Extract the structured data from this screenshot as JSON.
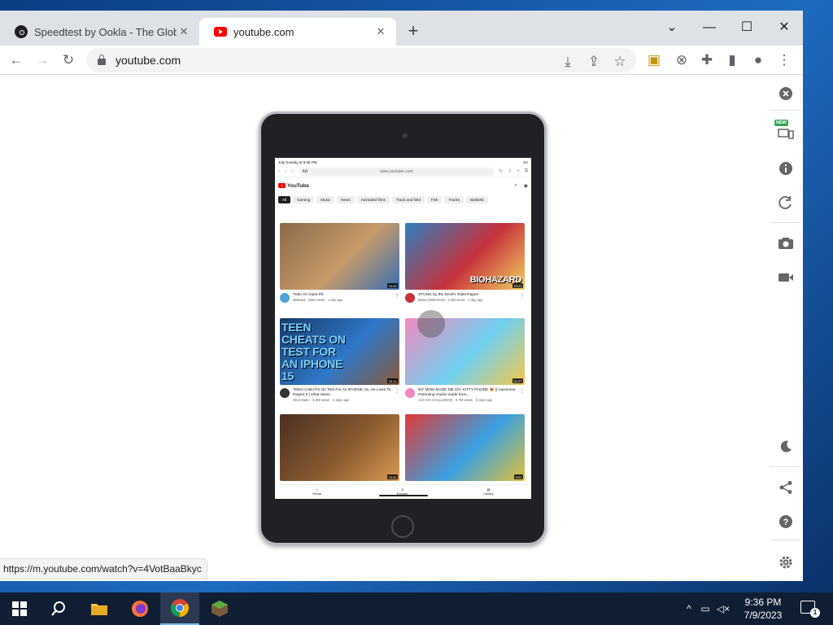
{
  "tabs": [
    {
      "title": "Speedtest by Ookla - The Global",
      "active": false
    },
    {
      "title": "youtube.com",
      "active": true
    }
  ],
  "omnibox": {
    "url": "youtube.com"
  },
  "status_url": "https://m.youtube.com/watch?v=4VotBaaBkyc",
  "device": {
    "status_time": "July Sunday at 9:36 PM",
    "status_right": "4G",
    "safari_url": "www.youtube.com",
    "aa": "AA",
    "logo": "YouTube",
    "chips": [
      "All",
      "Gaming",
      "Music",
      "News",
      "Animated films",
      "Track and field",
      "Fish",
      "Trucks",
      "Basketb"
    ],
    "videos": [
      {
        "title": "Train Vs Giant Pit",
        "sub": "MrBeast · 63M views · 1 day ago",
        "duration": "10:26",
        "thumb_text": "",
        "colors": [
          "#8b6a4a",
          "#c79a6a",
          "#3a6fb0"
        ],
        "avatar": "#4aa3d8"
      },
      {
        "title": "STUNG by the Devil's Toilet Paper!",
        "sub": "Brave Wilderness · 2.3M views · 1 day ago",
        "duration": "10:21",
        "thumb_text": "BIOHAZARD",
        "colors": [
          "#2f7fbf",
          "#c8323c",
          "#f0d060"
        ],
        "avatar": "#c8323c"
      },
      {
        "title": "TEEN CHEATS On Test For An IPHONE 15, He Lives To Regret It | Dhar Mann",
        "sub": "Dhar Mann · 5.3M views · 4 days ago",
        "duration": "16:14",
        "thumb_text": "TEEN CHEATS ON TEST FOR AN IPHONE 15",
        "colors": [
          "#173a6a",
          "#2f78c8",
          "#8a5a3a"
        ],
        "avatar": "#333333"
      },
      {
        "title": "MY MOM MADE ME DIY KITTY PHONE 😻 || Awesome Parenting Hacks made from...",
        "sub": "123 GO! CHALLENGE · 6.7M views · 5 days ago",
        "duration": "31:27",
        "thumb_text": "",
        "colors": [
          "#f08ac0",
          "#6fd0f0",
          "#f5c84a"
        ],
        "avatar": "#f08ac0"
      },
      {
        "title": "",
        "sub": "",
        "duration": "10:24",
        "thumb_text": "",
        "colors": [
          "#4a2f20",
          "#8a5a30",
          "#d89a50"
        ],
        "avatar": "#888888"
      },
      {
        "title": "",
        "sub": "",
        "duration": "9:02",
        "thumb_text": "",
        "colors": [
          "#e03a3a",
          "#3aa0e0",
          "#e0c03a"
        ],
        "avatar": "#888888"
      }
    ],
    "nav": [
      "Home",
      "Explore",
      "Library"
    ]
  },
  "taskbar": {
    "time": "9:36 PM",
    "date": "7/9/2023",
    "notifications": "1"
  }
}
